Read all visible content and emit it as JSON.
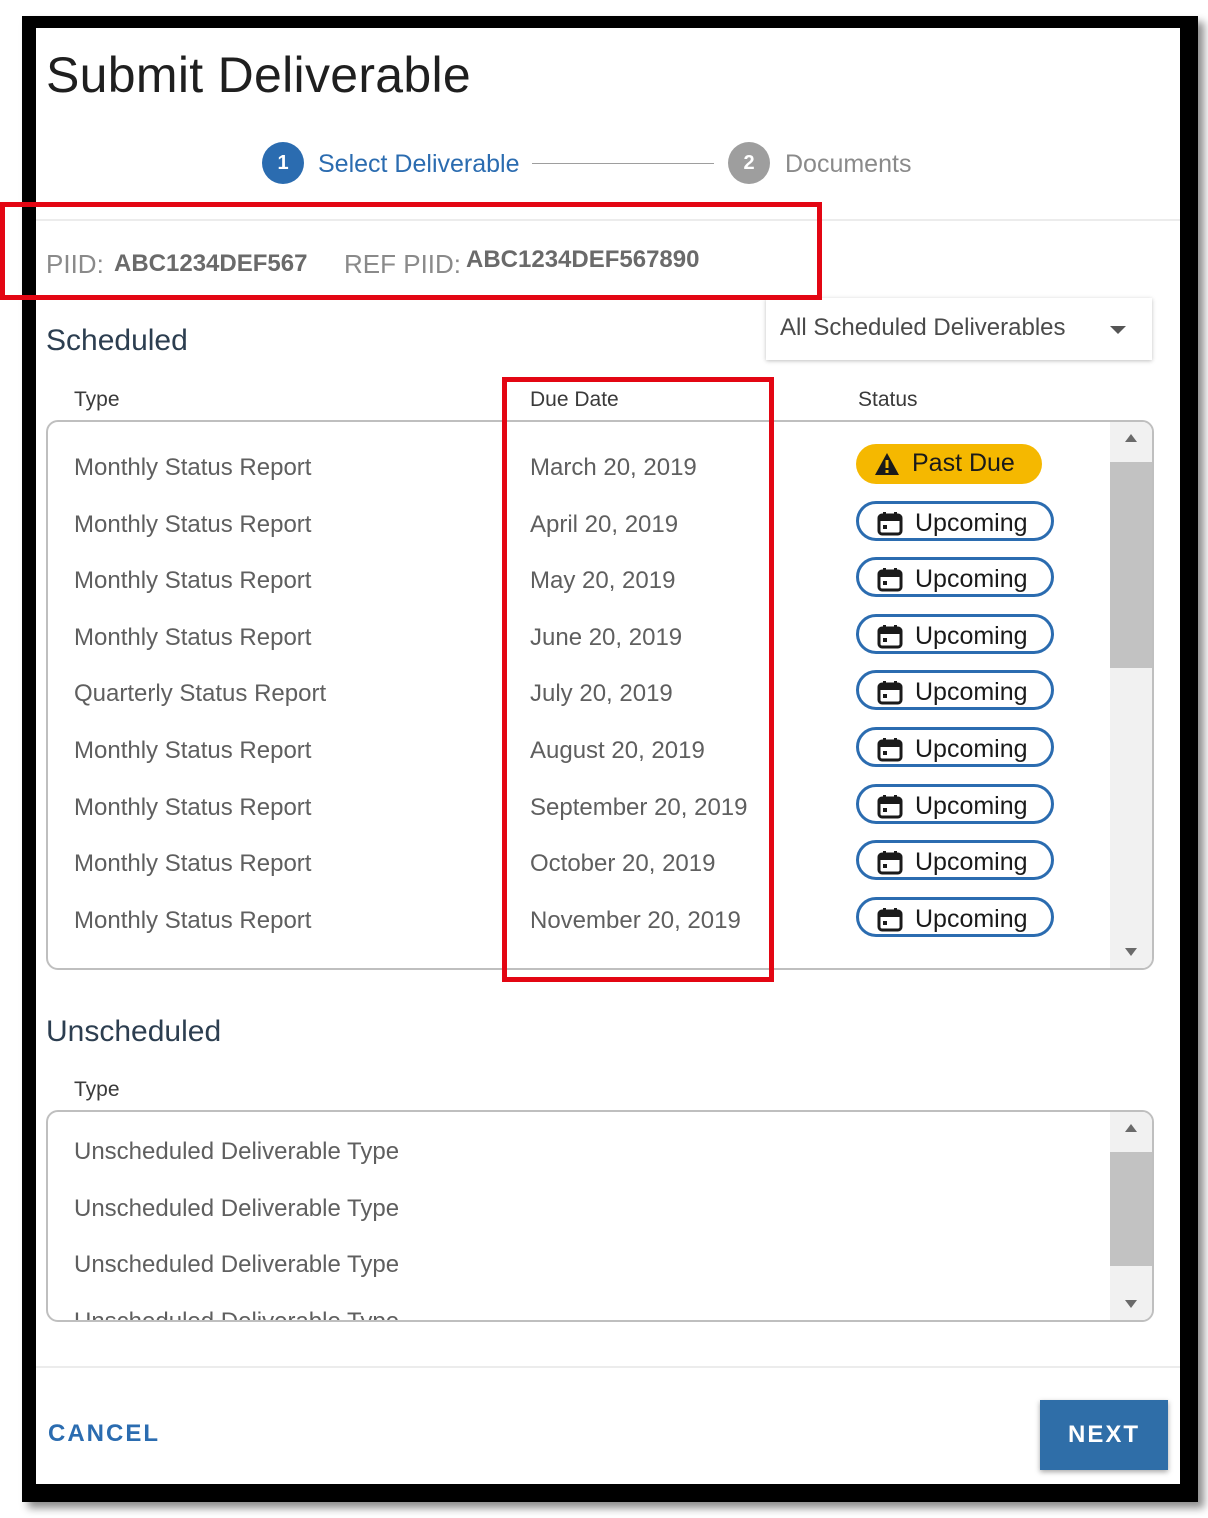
{
  "dialog": {
    "title": "Submit Deliverable",
    "stepper": [
      {
        "number": "1",
        "label": "Select Deliverable",
        "state": "active"
      },
      {
        "number": "2",
        "label": "Documents",
        "state": "inactive"
      }
    ],
    "piid_label": "PIID:",
    "piid_value": "ABC1234DEF567",
    "ref_piid_label": "REF PIID:",
    "ref_piid_value": "ABC1234DEF567890"
  },
  "scheduled": {
    "title": "Scheduled",
    "filter": {
      "selected": "All Scheduled Deliverables"
    },
    "columns": {
      "type": "Type",
      "due_date": "Due Date",
      "status": "Status"
    },
    "rows": [
      {
        "type": "Monthly Status Report",
        "due": "March 20, 2019",
        "status": "Past Due",
        "icon": "warning-icon"
      },
      {
        "type": "Monthly Status Report",
        "due": "April 20, 2019",
        "status": "Upcoming",
        "icon": "calendar-icon"
      },
      {
        "type": "Monthly Status Report",
        "due": "May 20, 2019",
        "status": "Upcoming",
        "icon": "calendar-icon"
      },
      {
        "type": "Monthly Status Report",
        "due": "June 20, 2019",
        "status": "Upcoming",
        "icon": "calendar-icon"
      },
      {
        "type": "Quarterly Status Report",
        "due": "July 20, 2019",
        "status": "Upcoming",
        "icon": "calendar-icon"
      },
      {
        "type": "Monthly Status Report",
        "due": "August 20, 2019",
        "status": "Upcoming",
        "icon": "calendar-icon"
      },
      {
        "type": "Monthly Status Report",
        "due": "September 20, 2019",
        "status": "Upcoming",
        "icon": "calendar-icon"
      },
      {
        "type": "Monthly Status Report",
        "due": "October 20, 2019",
        "status": "Upcoming",
        "icon": "calendar-icon"
      },
      {
        "type": "Monthly Status Report",
        "due": "November 20, 2019",
        "status": "Upcoming",
        "icon": "calendar-icon"
      }
    ]
  },
  "unscheduled": {
    "title": "Unscheduled",
    "columns": {
      "type": "Type"
    },
    "rows": [
      {
        "type": "Unscheduled Deliverable Type"
      },
      {
        "type": "Unscheduled Deliverable Type"
      },
      {
        "type": "Unscheduled Deliverable Type"
      },
      {
        "type": "Unscheduled Deliverable Type"
      }
    ]
  },
  "actions": {
    "cancel": "CANCEL",
    "next": "NEXT"
  },
  "colors": {
    "primary": "#2b6cb0",
    "past_due": "#f5b800",
    "annotation": "#e30613",
    "step_inactive": "#9e9e9e"
  }
}
